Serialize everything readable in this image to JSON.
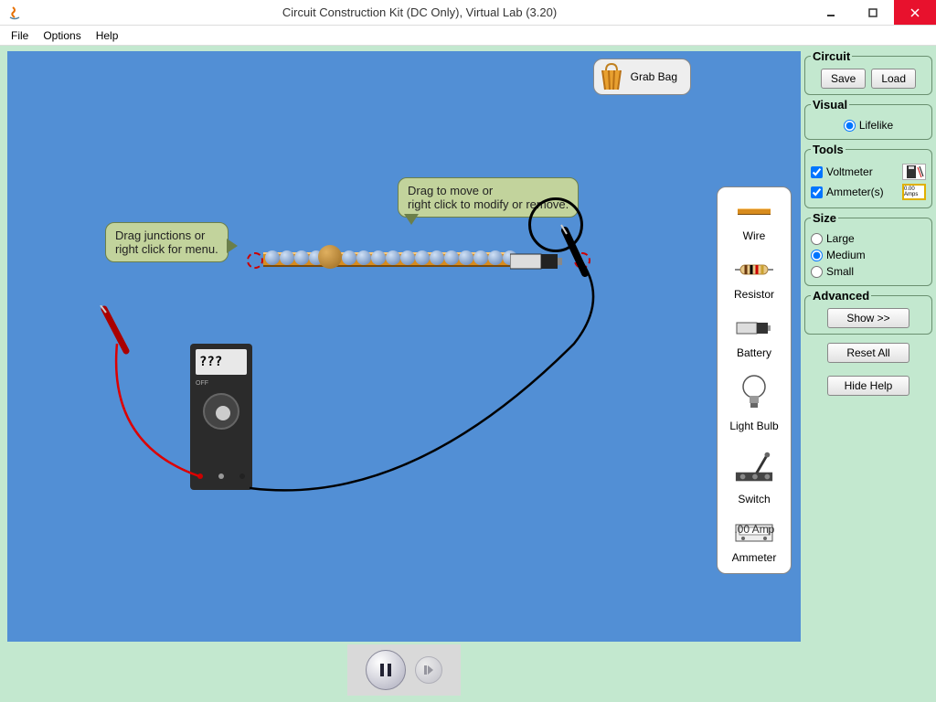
{
  "window": {
    "title": "Circuit Construction Kit (DC Only), Virtual Lab (3.20)"
  },
  "menubar": [
    "File",
    "Options",
    "Help"
  ],
  "grab_bag": {
    "label": "Grab Bag"
  },
  "palette": {
    "items": [
      {
        "label": "Wire"
      },
      {
        "label": "Resistor"
      },
      {
        "label": "Battery"
      },
      {
        "label": "Light Bulb"
      },
      {
        "label": "Switch"
      },
      {
        "label": "Ammeter"
      }
    ]
  },
  "tooltips": {
    "junction": "Drag junctions or\nright click for menu.",
    "component": "Drag to move or\nright click to modify or remove."
  },
  "voltmeter": {
    "display": "???"
  },
  "sidebar": {
    "circuit": {
      "legend": "Circuit",
      "save": "Save",
      "load": "Load"
    },
    "visual": {
      "legend": "Visual",
      "lifelike": "Lifelike"
    },
    "tools": {
      "legend": "Tools",
      "voltmeter": "Voltmeter",
      "ammeter": "Ammeter(s)",
      "ammeter_icon_text": "0.00 Amps"
    },
    "size": {
      "legend": "Size",
      "large": "Large",
      "medium": "Medium",
      "small": "Small"
    },
    "advanced": {
      "legend": "Advanced",
      "show": "Show >>",
      "reset": "Reset All",
      "hide_help": "Hide Help"
    }
  }
}
